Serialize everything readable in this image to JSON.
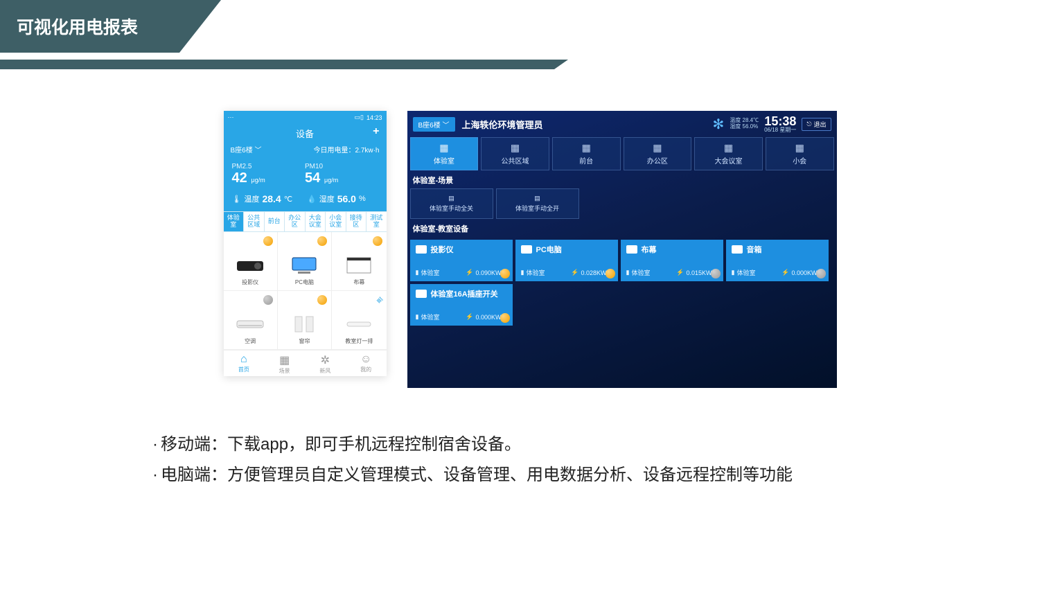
{
  "slide": {
    "title": "可视化用电报表",
    "bullets": [
      "移动端：下载app，即可手机远程控制宿舍设备。",
      "电脑端：方便管理员自定义管理模式、设备管理、用电数据分析、设备远程控制等功能"
    ]
  },
  "mobile": {
    "status_left": "⋯",
    "status_right_signal": "▭▯",
    "status_time": "14:23",
    "title": "设备",
    "plus": "+",
    "location": "B座6楼",
    "usage_label": "今日用电量：2.7kw·h",
    "pm25": {
      "label": "PM2.5",
      "value": "42",
      "unit": "μg/m"
    },
    "pm10": {
      "label": "PM10",
      "value": "54",
      "unit": "μg/m"
    },
    "temp": {
      "label": "温度",
      "value": "28.4",
      "unit": "℃"
    },
    "humid": {
      "label": "湿度",
      "value": "56.0",
      "unit": "%"
    },
    "tabs": [
      "体验室",
      "公共区域",
      "前台",
      "办公区",
      "大会议室",
      "小会议室",
      "接待区",
      "测试室"
    ],
    "devices": [
      {
        "name": "投影仪",
        "status": "on"
      },
      {
        "name": "PC电脑",
        "status": "on"
      },
      {
        "name": "布幕",
        "status": "on"
      },
      {
        "name": "空调",
        "status": "off"
      },
      {
        "name": "窗帘",
        "status": "on"
      },
      {
        "name": "教室灯一排",
        "status": "wifi"
      }
    ],
    "nav": [
      {
        "label": "首页",
        "active": true
      },
      {
        "label": "场景",
        "active": false
      },
      {
        "label": "新风",
        "active": false
      },
      {
        "label": "我的",
        "active": false
      }
    ]
  },
  "desktop": {
    "location_btn": "B座6楼",
    "title": "上海轶伦环境管理员",
    "env": {
      "temp_label": "温度 28.4℃",
      "humid_label": "湿度 56.0%"
    },
    "time": "15:38",
    "date": "06/18 星期一",
    "logout": "退出",
    "nav": [
      "体验室",
      "公共区域",
      "前台",
      "办公区",
      "大会议室",
      "小会"
    ],
    "section_scene": "体验室-场景",
    "scenes": [
      "体验室手动全关",
      "体验室手动全开"
    ],
    "section_devices": "体验室-教室设备",
    "devices": [
      {
        "name": "投影仪",
        "room": "体验室",
        "power": "0.090KW·h",
        "status": "on"
      },
      {
        "name": "PC电脑",
        "room": "体验室",
        "power": "0.028KW·h",
        "status": "on"
      },
      {
        "name": "布幕",
        "room": "体验室",
        "power": "0.015KW·h",
        "status": "off"
      },
      {
        "name": "音箱",
        "room": "体验室",
        "power": "0.000KW·h",
        "status": "off"
      },
      {
        "name": "体验室16A插座开关",
        "room": "体验室",
        "power": "0.000KW·h",
        "status": "on"
      }
    ]
  },
  "colors": {
    "banner": "#3e5f66",
    "mobile_blue": "#29a6e6",
    "desktop_card": "#1e8fe0",
    "badge_on": "#f4a100",
    "badge_off": "#9a9a9a"
  }
}
